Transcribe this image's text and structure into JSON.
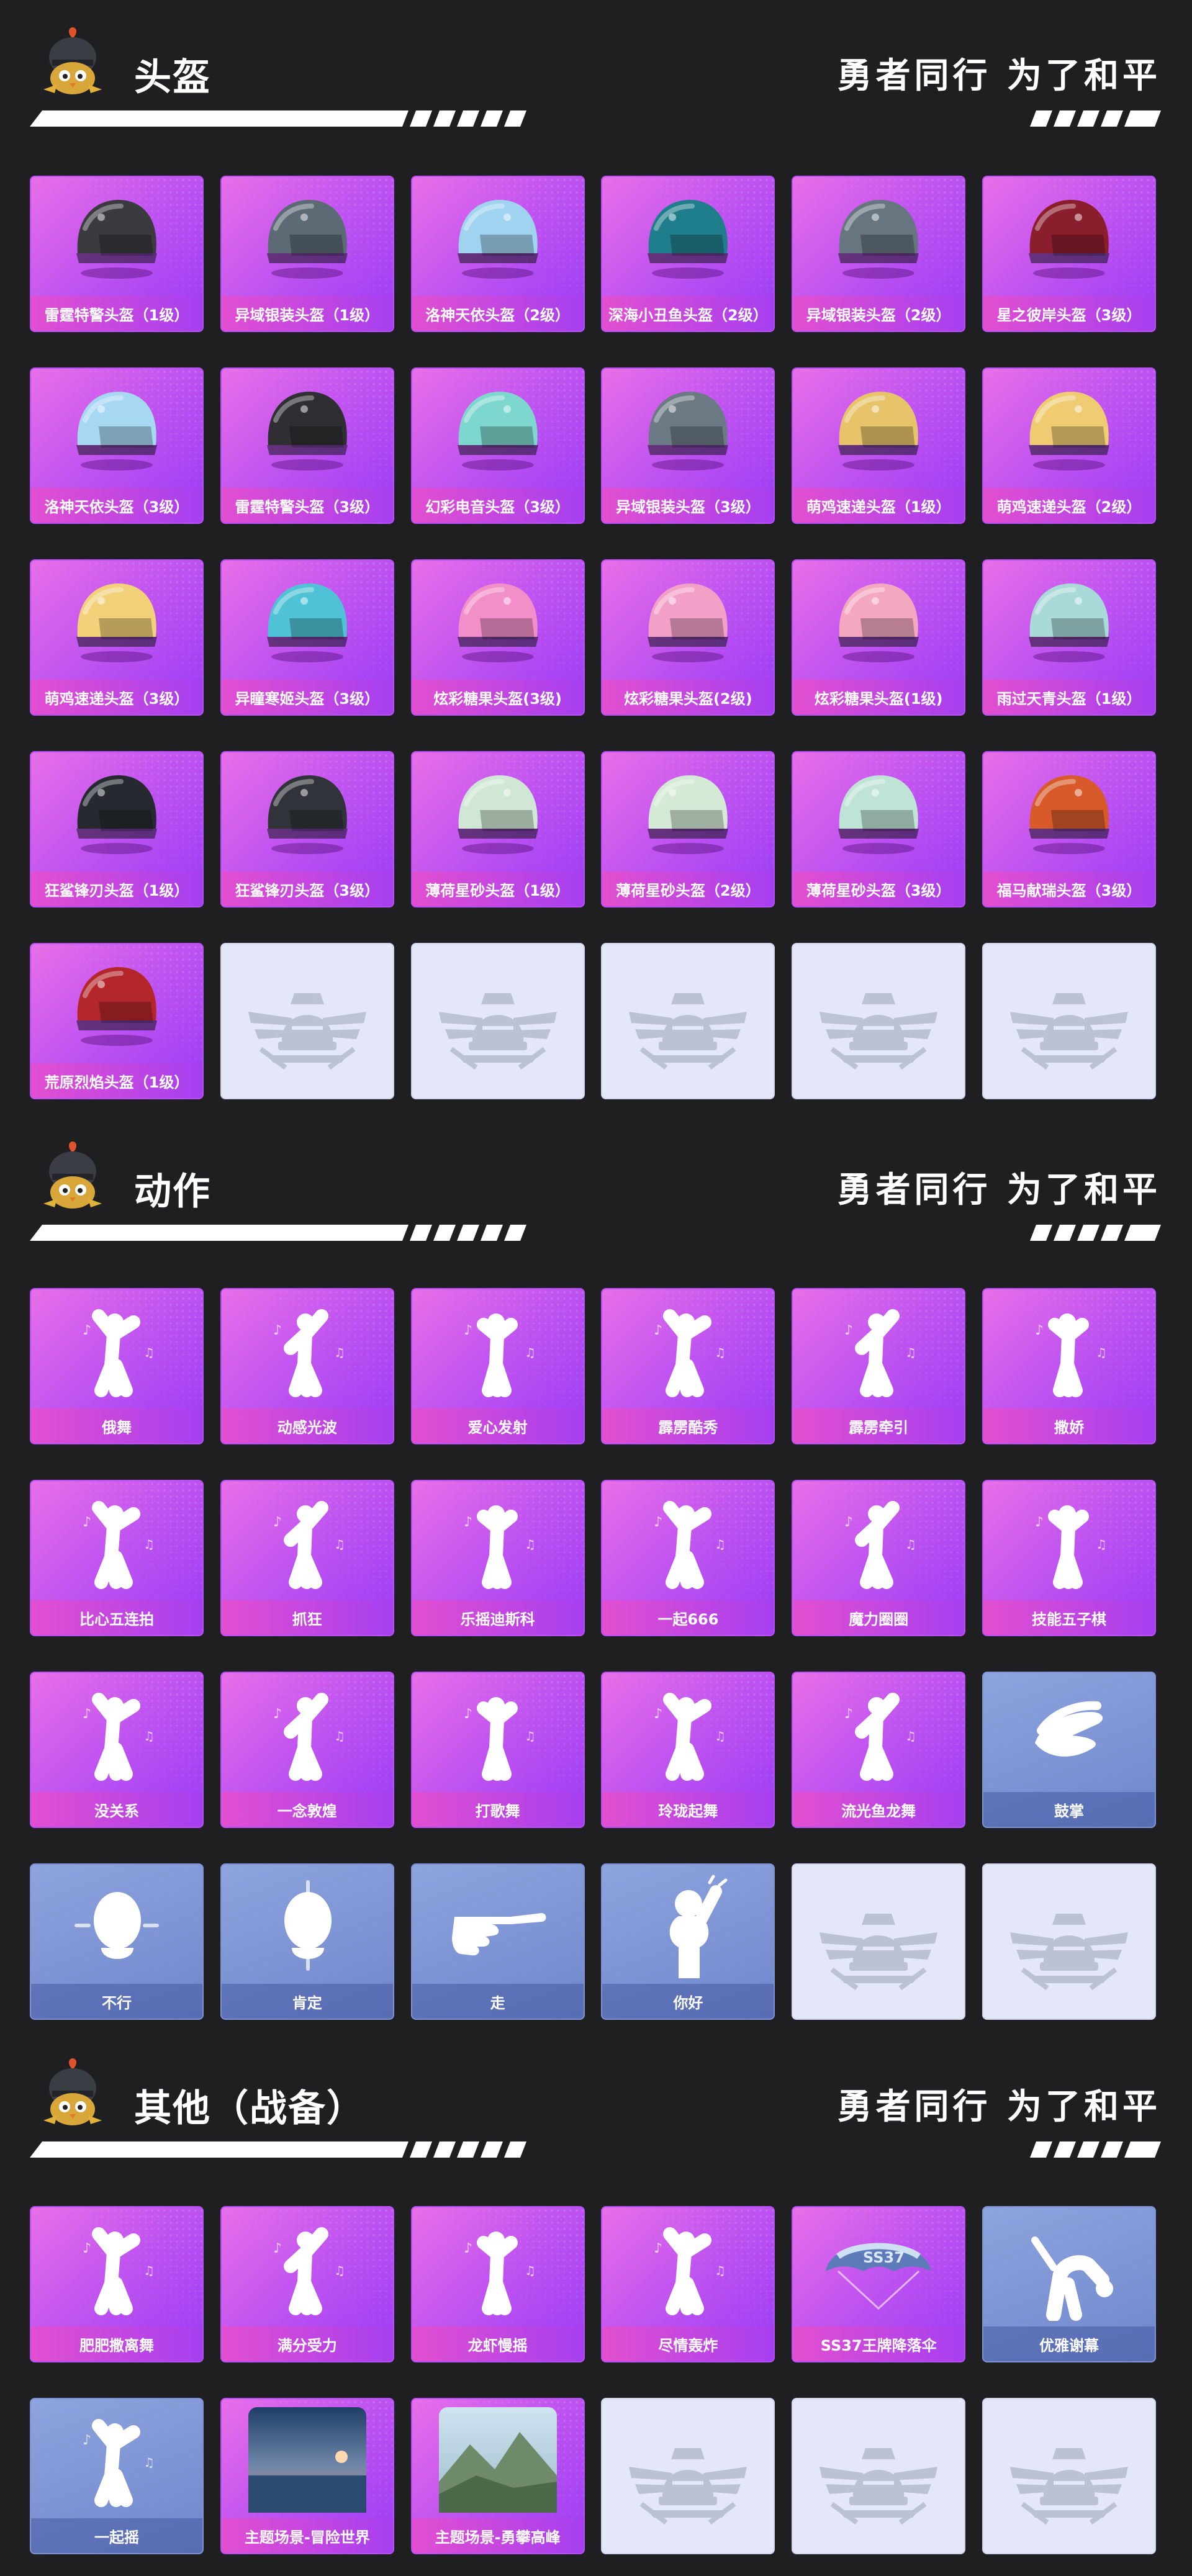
{
  "slogan": "勇者同行 为了和平",
  "colors": {
    "background": "#1f1f21",
    "card_purple": "#c255f0",
    "card_blue": "#7d93d6",
    "card_empty": "#e3e7f7"
  },
  "sections": [
    {
      "title": "头盔",
      "kind": "helmet",
      "items": [
        {
          "label": "雷霆特警头盔（1级）",
          "style": "purple",
          "icon": "helmet-icon",
          "tint": "#3a3a3f"
        },
        {
          "label": "异域银装头盔（1级）",
          "style": "purple",
          "icon": "helmet-icon",
          "tint": "#5b6a74"
        },
        {
          "label": "洛神天依头盔（2级）",
          "style": "purple",
          "icon": "helmet-icon",
          "tint": "#9fd3ef"
        },
        {
          "label": "深海小丑鱼头盔（2级）",
          "style": "purple",
          "icon": "helmet-icon",
          "tint": "#1f7e8c"
        },
        {
          "label": "异域银装头盔（2级）",
          "style": "purple",
          "icon": "helmet-icon",
          "tint": "#66757f"
        },
        {
          "label": "星之彼岸头盔（3级）",
          "style": "purple",
          "icon": "helmet-icon",
          "tint": "#8a1e2c"
        },
        {
          "label": "洛神天依头盔（3级）",
          "style": "purple",
          "icon": "helmet-icon",
          "tint": "#a7d8f2"
        },
        {
          "label": "雷霆特警头盔（3级）",
          "style": "purple",
          "icon": "helmet-icon",
          "tint": "#2f2f33"
        },
        {
          "label": "幻彩电音头盔（3级）",
          "style": "purple",
          "icon": "helmet-icon",
          "tint": "#7ed7cf"
        },
        {
          "label": "异域银装头盔（3级）",
          "style": "purple",
          "icon": "helmet-icon",
          "tint": "#6c7a85"
        },
        {
          "label": "萌鸡速递头盔（1级）",
          "style": "purple",
          "icon": "helmet-icon",
          "tint": "#e7c46a"
        },
        {
          "label": "萌鸡速递头盔（2级）",
          "style": "purple",
          "icon": "helmet-icon",
          "tint": "#efcc72"
        },
        {
          "label": "萌鸡速递头盔（3级）",
          "style": "purple",
          "icon": "helmet-icon",
          "tint": "#f2d17a"
        },
        {
          "label": "异瞳寒姬头盔（3级）",
          "style": "purple",
          "icon": "helmet-icon",
          "tint": "#4fc2d6"
        },
        {
          "label": "炫彩糖果头盔(3级)",
          "style": "purple",
          "icon": "helmet-icon",
          "tint": "#f28fc9"
        },
        {
          "label": "炫彩糖果头盔(2级)",
          "style": "purple",
          "icon": "helmet-icon",
          "tint": "#f3a0c9"
        },
        {
          "label": "炫彩糖果头盔(1级)",
          "style": "purple",
          "icon": "helmet-icon",
          "tint": "#f4a8c0"
        },
        {
          "label": "雨过天青头盔（1级）",
          "style": "purple",
          "icon": "helmet-icon",
          "tint": "#a9d9d8"
        },
        {
          "label": "狂鲨锋刃头盔（1级）",
          "style": "purple",
          "icon": "helmet-icon",
          "tint": "#262a30"
        },
        {
          "label": "狂鲨锋刃头盔（3级）",
          "style": "purple",
          "icon": "helmet-icon",
          "tint": "#30343a"
        },
        {
          "label": "薄荷星砂头盔（1级）",
          "style": "purple",
          "icon": "helmet-icon",
          "tint": "#cfe7d4"
        },
        {
          "label": "薄荷星砂头盔（2级）",
          "style": "purple",
          "icon": "helmet-icon",
          "tint": "#d4e9d6"
        },
        {
          "label": "薄荷星砂头盔（3级）",
          "style": "purple",
          "icon": "helmet-icon",
          "tint": "#bfe4d6"
        },
        {
          "label": "福马献瑞头盔（3级）",
          "style": "purple",
          "icon": "helmet-icon",
          "tint": "#d85a2a"
        },
        {
          "label": "荒原烈焰头盔（1级）",
          "style": "purple",
          "icon": "helmet-icon",
          "tint": "#b3262a"
        },
        {
          "label": "",
          "style": "empty",
          "icon": "empty-emblem-icon",
          "tint": ""
        },
        {
          "label": "",
          "style": "empty",
          "icon": "empty-emblem-icon",
          "tint": ""
        },
        {
          "label": "",
          "style": "empty",
          "icon": "empty-emblem-icon",
          "tint": ""
        },
        {
          "label": "",
          "style": "empty",
          "icon": "empty-emblem-icon",
          "tint": ""
        },
        {
          "label": "",
          "style": "empty",
          "icon": "empty-emblem-icon",
          "tint": ""
        }
      ]
    },
    {
      "title": "动作",
      "kind": "emote",
      "items": [
        {
          "label": "俄舞",
          "style": "purple",
          "icon": "dancer-icon",
          "tint": ""
        },
        {
          "label": "动感光波",
          "style": "purple",
          "icon": "dancer-icon",
          "tint": ""
        },
        {
          "label": "爱心发射",
          "style": "purple",
          "icon": "dancer-icon",
          "tint": ""
        },
        {
          "label": "霹雳酷秀",
          "style": "purple",
          "icon": "dancer-icon",
          "tint": ""
        },
        {
          "label": "霹雳牵引",
          "style": "purple",
          "icon": "dancer-icon",
          "tint": ""
        },
        {
          "label": "撒娇",
          "style": "purple",
          "icon": "dancer-icon",
          "tint": ""
        },
        {
          "label": "比心五连拍",
          "style": "purple",
          "icon": "dancer-icon",
          "tint": ""
        },
        {
          "label": "抓狂",
          "style": "purple",
          "icon": "dancer-icon",
          "tint": ""
        },
        {
          "label": "乐摇迪斯科",
          "style": "purple",
          "icon": "dancer-icon",
          "tint": ""
        },
        {
          "label": "一起666",
          "style": "purple",
          "icon": "dancer-icon",
          "tint": ""
        },
        {
          "label": "魔力圈圈",
          "style": "purple",
          "icon": "dancer-icon",
          "tint": ""
        },
        {
          "label": "技能五子棋",
          "style": "purple",
          "icon": "dancer-icon",
          "tint": ""
        },
        {
          "label": "没关系",
          "style": "purple",
          "icon": "dancer-icon",
          "tint": ""
        },
        {
          "label": "一念敦煌",
          "style": "purple",
          "icon": "dancer-icon",
          "tint": ""
        },
        {
          "label": "打歌舞",
          "style": "purple",
          "icon": "dancer-icon",
          "tint": ""
        },
        {
          "label": "玲珑起舞",
          "style": "purple",
          "icon": "dancer-icon",
          "tint": ""
        },
        {
          "label": "流光鱼龙舞",
          "style": "purple",
          "icon": "dancer-icon",
          "tint": ""
        },
        {
          "label": "鼓掌",
          "style": "blue",
          "icon": "clap-icon",
          "tint": ""
        },
        {
          "label": "不行",
          "style": "blue",
          "icon": "head-shake-icon",
          "tint": ""
        },
        {
          "label": "肯定",
          "style": "blue",
          "icon": "head-nod-icon",
          "tint": ""
        },
        {
          "label": "走",
          "style": "blue",
          "icon": "pointing-hand-icon",
          "tint": ""
        },
        {
          "label": "你好",
          "style": "blue",
          "icon": "wave-icon",
          "tint": ""
        },
        {
          "label": "",
          "style": "empty",
          "icon": "empty-emblem-icon",
          "tint": ""
        },
        {
          "label": "",
          "style": "empty",
          "icon": "empty-emblem-icon",
          "tint": ""
        }
      ]
    },
    {
      "title": "其他（战备）",
      "kind": "other",
      "items": [
        {
          "label": "肥肥撒离舞",
          "style": "purple",
          "icon": "dancer-icon",
          "tint": ""
        },
        {
          "label": "满分受力",
          "style": "purple",
          "icon": "dancer-icon",
          "tint": ""
        },
        {
          "label": "龙虾慢摇",
          "style": "purple",
          "icon": "dancer-icon",
          "tint": ""
        },
        {
          "label": "尽情轰炸",
          "style": "purple",
          "icon": "dancer-icon",
          "tint": ""
        },
        {
          "label": "SS37王牌降落伞",
          "style": "purple",
          "icon": "parachute-icon",
          "tint": ""
        },
        {
          "label": "优雅谢幕",
          "style": "blue",
          "icon": "bow-icon",
          "tint": ""
        },
        {
          "label": "一起摇",
          "style": "blue",
          "icon": "dancer-icon",
          "tint": ""
        },
        {
          "label": "主题场景-冒险世界",
          "style": "purple",
          "icon": "scene-sea-icon",
          "tint": ""
        },
        {
          "label": "主题场景-勇攀高峰",
          "style": "purple",
          "icon": "scene-mountain-icon",
          "tint": ""
        },
        {
          "label": "",
          "style": "empty",
          "icon": "empty-emblem-icon",
          "tint": ""
        },
        {
          "label": "",
          "style": "empty",
          "icon": "empty-emblem-icon",
          "tint": ""
        },
        {
          "label": "",
          "style": "empty",
          "icon": "empty-emblem-icon",
          "tint": ""
        }
      ]
    }
  ]
}
